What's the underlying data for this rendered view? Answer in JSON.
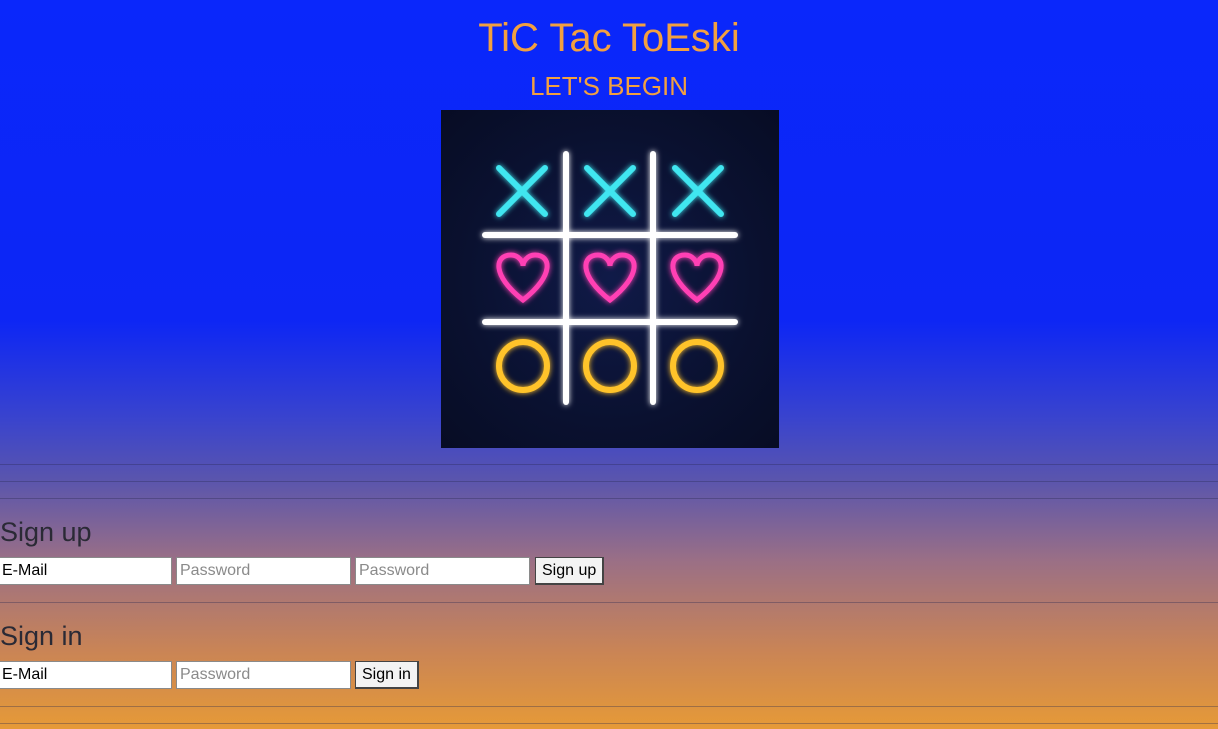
{
  "header": {
    "title": "TiC Tac ToEski",
    "subtitle": "LET'S BEGIN"
  },
  "board": {
    "rows": [
      [
        "x-icon",
        "x-icon",
        "x-icon"
      ],
      [
        "heart-icon",
        "heart-icon",
        "heart-icon"
      ],
      [
        "o-icon",
        "o-icon",
        "o-icon"
      ]
    ],
    "colors": {
      "x": "#3fe6f0",
      "heart": "#ff3fb4",
      "o": "#ffc32a",
      "grid": "#ffffff",
      "background": "#0a1130"
    }
  },
  "signup": {
    "heading": "Sign up",
    "email_value": "E-Mail",
    "password_placeholder": "Password",
    "confirm_placeholder": "Password",
    "button_label": "Sign up"
  },
  "signin": {
    "heading": "Sign in",
    "email_value": "E-Mail",
    "password_placeholder": "Password",
    "button_label": "Sign in"
  },
  "colors": {
    "accent": "#f2a040",
    "background_top": "#0a27fb",
    "background_bottom": "#e69a37"
  }
}
